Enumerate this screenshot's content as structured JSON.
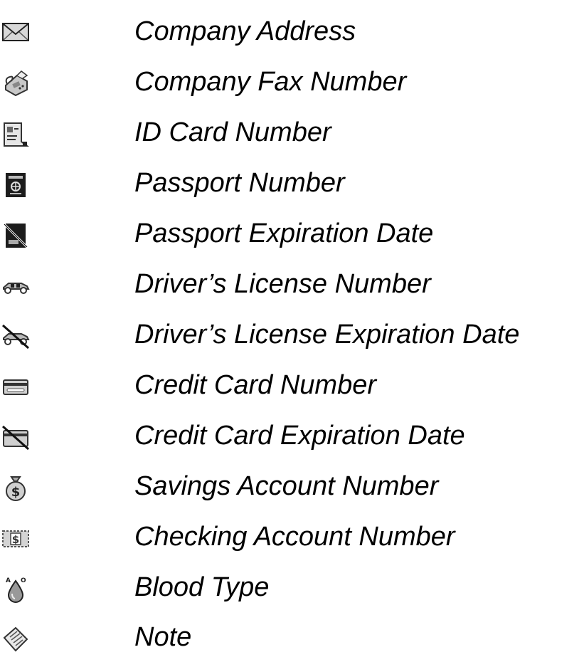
{
  "items": [
    {
      "icon": "envelope-icon",
      "label": "Company Address"
    },
    {
      "icon": "fax-machine-icon",
      "label": "Company Fax Number"
    },
    {
      "icon": "id-card-icon",
      "label": "ID Card Number"
    },
    {
      "icon": "passport-icon",
      "label": "Passport Number"
    },
    {
      "icon": "passport-expired-icon",
      "label": "Passport Expiration Date"
    },
    {
      "icon": "car-icon",
      "label": "Driver’s License Number"
    },
    {
      "icon": "car-expired-icon",
      "label": "Driver’s License Expiration Date"
    },
    {
      "icon": "credit-card-icon",
      "label": "Credit Card Number"
    },
    {
      "icon": "credit-card-expired-icon",
      "label": "Credit Card Expiration Date"
    },
    {
      "icon": "money-bag-icon",
      "label": "Savings Account Number"
    },
    {
      "icon": "check-icon",
      "label": "Checking Account Number"
    },
    {
      "icon": "blood-drop-icon",
      "label": "Blood Type"
    },
    {
      "icon": "note-icon",
      "label": "Note"
    }
  ]
}
